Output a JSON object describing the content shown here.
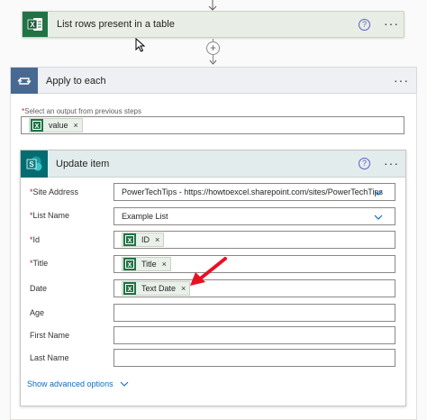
{
  "list_rows_card": {
    "title": "List rows present in a table",
    "help_glyph": "?",
    "more_glyph": "···"
  },
  "apply_to_each": {
    "title": "Apply to each",
    "more_glyph": "···",
    "select_label_req": "*",
    "select_label": "Select an output from previous steps",
    "token": {
      "label": "value",
      "remove": "×"
    }
  },
  "update_item": {
    "title": "Update item",
    "help_glyph": "?",
    "more_glyph": "···",
    "fields": {
      "site_address": {
        "label": "Site Address",
        "required": "*",
        "value": "PowerTechTips - https://howtoexcel.sharepoint.com/sites/PowerTechTips"
      },
      "list_name": {
        "label": "List Name",
        "required": "*",
        "value": "Example List"
      },
      "id": {
        "label": "Id",
        "required": "*",
        "token": "ID",
        "remove": "×"
      },
      "title": {
        "label": "Title",
        "required": "*",
        "token": "Title",
        "remove": "×"
      },
      "date": {
        "label": "Date",
        "token": "Text Date",
        "remove": "×"
      },
      "age": {
        "label": "Age",
        "value": ""
      },
      "first_name": {
        "label": "First Name",
        "value": ""
      },
      "last_name": {
        "label": "Last Name",
        "value": ""
      }
    },
    "advanced_link": "Show advanced options"
  },
  "colors": {
    "excel_green": "#217346",
    "loop_blue": "#486991",
    "sharepoint_teal": "#036c70",
    "link_blue": "#0f6cbd",
    "annotation_red": "#e81123"
  },
  "icons": [
    "excel-icon",
    "loop-icon",
    "sharepoint-icon",
    "chevron-down-icon",
    "plus-icon",
    "arrow-down-icon",
    "cursor-icon",
    "annotation-arrow-icon"
  ]
}
